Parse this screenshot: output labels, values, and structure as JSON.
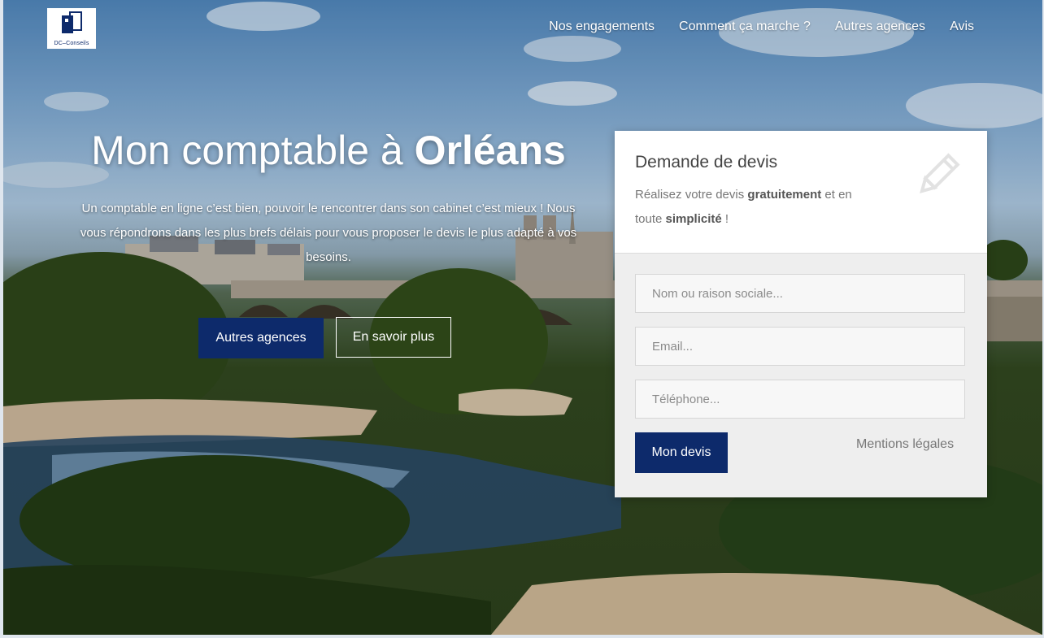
{
  "brand": {
    "logo_text": "DC–Conseils",
    "primary_color": "#0d2a6b"
  },
  "nav": [
    {
      "label": "Nos engagements"
    },
    {
      "label": "Comment ça marche ?"
    },
    {
      "label": "Autres agences"
    },
    {
      "label": "Avis"
    }
  ],
  "hero": {
    "title_prefix": "Mon comptable à ",
    "title_city": "Orléans",
    "subtitle": "Un comptable en ligne c’est bien, pouvoir le rencontrer dans son cabinet c’est mieux ! Nous vous répondrons dans les plus brefs délais pour vous proposer le devis le plus adapté à vos besoins.",
    "btn_primary": "Autres agences",
    "btn_secondary": "En savoir plus"
  },
  "quote": {
    "title": "Demande de devis",
    "desc_1": "Réalisez votre devis ",
    "desc_bold_1": "gratuitement",
    "desc_2": " et en toute ",
    "desc_bold_2": "simplicité",
    "desc_3": " !",
    "icon": "pencil-icon",
    "fields": [
      {
        "placeholder": "Nom ou raison sociale..."
      },
      {
        "placeholder": "Email..."
      },
      {
        "placeholder": "Téléphone..."
      }
    ],
    "submit": "Mon devis",
    "legal": "Mentions légales"
  }
}
